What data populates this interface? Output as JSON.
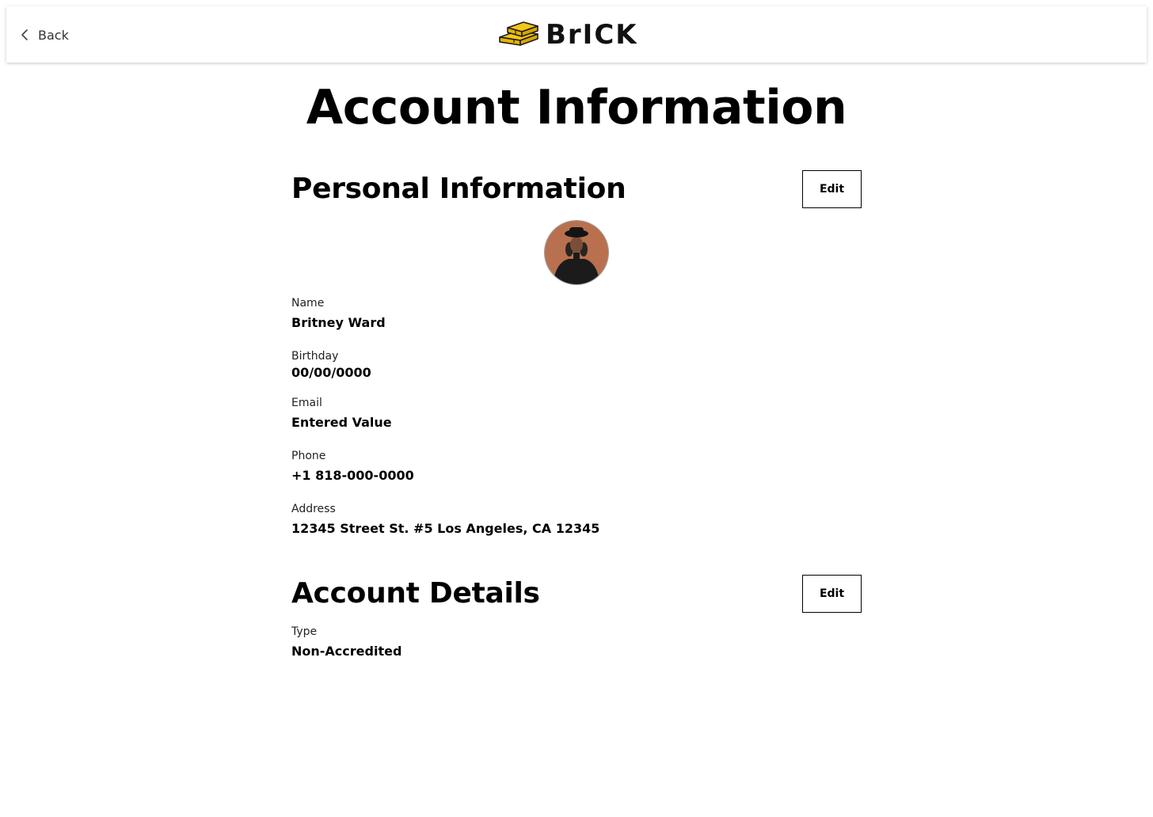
{
  "header": {
    "back_label": "Back",
    "logo_text": "BrICK",
    "brand_color": "#F5C518"
  },
  "page_title": "Account Information",
  "personal": {
    "title": "Personal Information",
    "edit_label": "Edit",
    "fields": [
      {
        "label": "Name",
        "value": "Britney Ward"
      },
      {
        "label": "Birthday",
        "value": "00/00/0000"
      },
      {
        "label": "Email",
        "value": "Entered Value"
      },
      {
        "label": "Phone",
        "value": "+1 818-000-0000"
      },
      {
        "label": "Address",
        "value": "12345 Street St. #5 Los Angeles, CA 12345"
      }
    ]
  },
  "account": {
    "title": "Account Details",
    "edit_label": "Edit",
    "fields": [
      {
        "label": "Type",
        "value": "Non-Accredited"
      }
    ]
  },
  "icons": {
    "back": "chevron-left-icon",
    "logo": "brick-stack-icon"
  }
}
